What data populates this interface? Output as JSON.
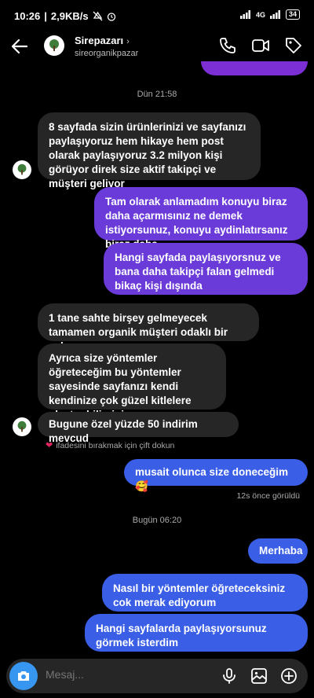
{
  "status": {
    "time": "10:26",
    "speed": "2,9KB/s",
    "network": "4G",
    "battery": "34"
  },
  "header": {
    "name": "Sirepazarı",
    "username": "sireorganikpazar"
  },
  "timestamps": {
    "first": "Dün 21:58",
    "second": "Bugün 06:20"
  },
  "messages": [
    {
      "text": "8 sayfada sizin ürünlerinizi ve sayfanızı paylaşıyoruz hem hikaye hem post olarak paylaşıyoruz 3.2 milyon kişi görüyor direk size aktif takipçi ve müşteri geliyor"
    },
    {
      "text": "Tam olarak anlamadım konuyu biraz daha açarmısınız ne demek istiyorsunuz, konuyu  aydinlatırsanız biraz daha..."
    },
    {
      "text": "Hangi sayfada paylaşıyorsnuz ve bana daha takipçi falan gelmedi bikaç kişi dışında"
    },
    {
      "text": "1 tane sahte birşey gelmeyecek tamamen organik müşteri odaklı bir çalışma"
    },
    {
      "text": "Ayrıca size yöntemler öğreteceğim bu yöntemler sayesinde sayfanızı kendi kendinize çok güzel kitlelere ulaştırabilirsiniz"
    },
    {
      "text": "Bugune özel yüzde 50 indirim mevcud"
    },
    {
      "text": "musait olunca  size doneceğim  🥰"
    },
    {
      "text": "Merhaba"
    },
    {
      "text": "Nasıl bir yöntemler öğreteceksiniz cok merak ediyorum"
    },
    {
      "text": "Hangi sayfalarda paylaşıyorsunuz görmek isterdim"
    }
  ],
  "hint": "ifadesini bırakmak için çift dokun",
  "seen": "12s önce görüldü",
  "composer": {
    "placeholder": "Mesaj..."
  },
  "colors": {
    "accent_blue": "#3797f0",
    "bubble_purple": "#6b3bd9",
    "bubble_blue": "#3a5ee6",
    "bubble_incoming": "#262626"
  }
}
